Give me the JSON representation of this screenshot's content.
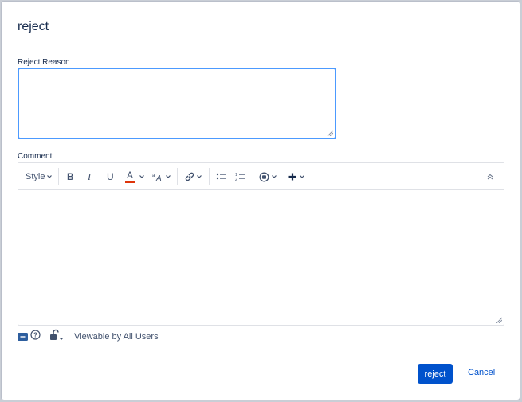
{
  "dialog": {
    "title": "reject",
    "reject_reason_label": "Reject Reason",
    "reject_reason_value": "",
    "comment_label": "Comment"
  },
  "toolbar": {
    "style_label": "Style",
    "bold_label": "B",
    "italic_label": "I",
    "underline_label": "U",
    "text_color_label": "A",
    "text_color": "#de350b",
    "icons": [
      "bold-icon",
      "italic-icon",
      "underline-icon",
      "text-color-icon",
      "text-format-icon",
      "link-icon",
      "bullet-list-icon",
      "numbered-list-icon",
      "emoji-icon",
      "insert-more-icon",
      "collapse-toolbar-icon"
    ]
  },
  "comment": {
    "value": ""
  },
  "visibility": {
    "label": "Viewable by All Users"
  },
  "actions": {
    "primary_label": "reject",
    "cancel_label": "Cancel"
  },
  "colors": {
    "primary": "#0052cc",
    "focus_border": "#4c9aff",
    "border": "#dfe1e6"
  }
}
